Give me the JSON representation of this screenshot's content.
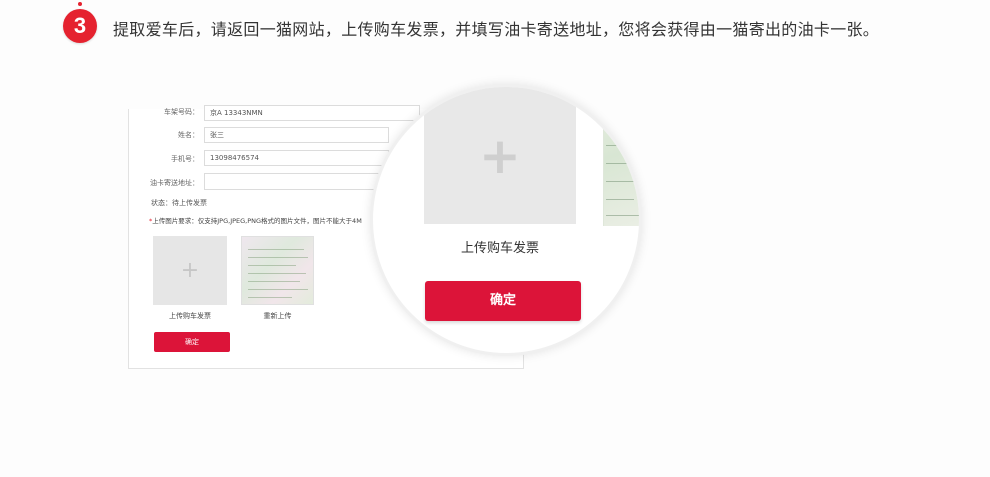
{
  "step": {
    "number": "3",
    "instruction": "提取爱车后，请返回一猫网站，上传购车发票，并填写油卡寄送地址，您将会获得由一猫寄出的油卡一张。"
  },
  "form": {
    "fields": [
      {
        "label": "车架号码：",
        "value": "京A 13343NMN"
      },
      {
        "label": "姓名：",
        "value": "张三"
      },
      {
        "label": "手机号：",
        "value": "13098476574"
      },
      {
        "label": "油卡寄送地址：",
        "value": ""
      }
    ],
    "status": "状态：待上传发票",
    "requirement_star": "*",
    "requirement": "上传图片要求：仅支持JPG,JPEG,PNG格式的图片文件，图片不能大于4M",
    "upload_caption": "上传购车发票",
    "reupload_caption": "重新上传",
    "plus_symbol": "+",
    "submit_label": "确定"
  },
  "magnifier": {
    "upload_caption": "上传购车发票",
    "plus_symbol": "+",
    "submit_label": "确定"
  },
  "colors": {
    "accent": "#dc1439",
    "badge": "#e5222f"
  }
}
